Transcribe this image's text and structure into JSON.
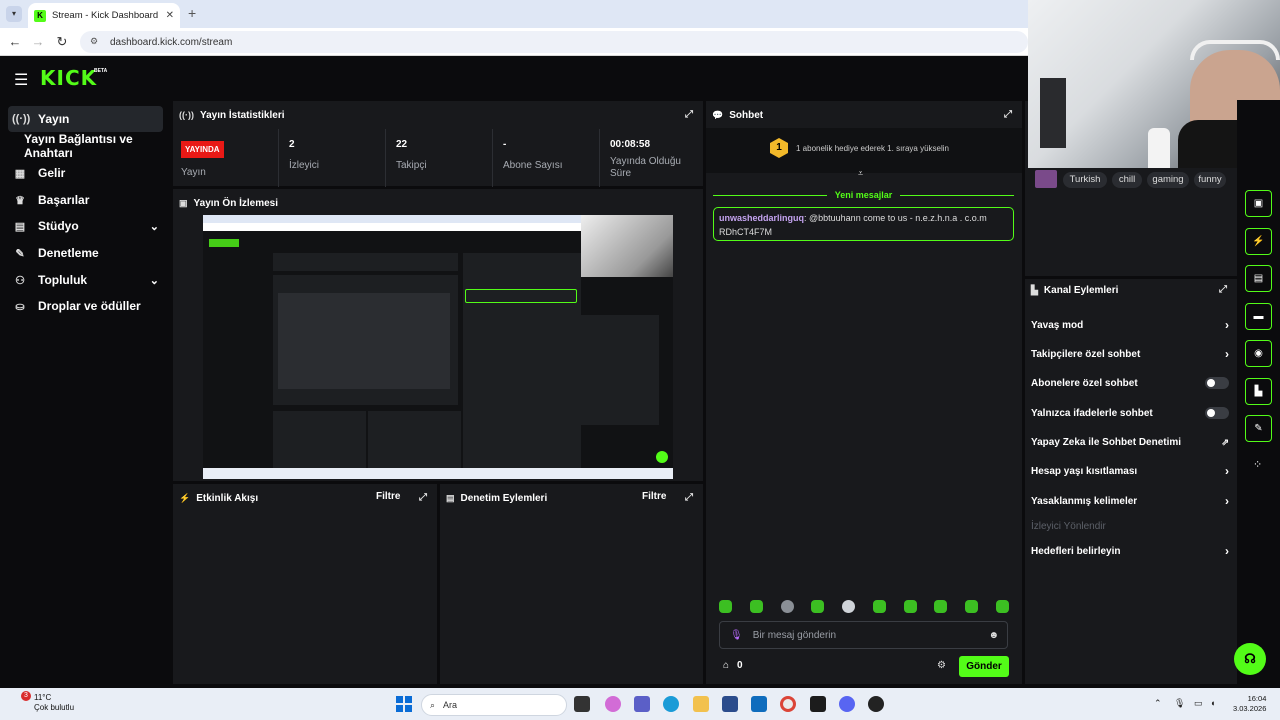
{
  "browser": {
    "tab_title": "Stream - Kick Dashboard",
    "tab_close": "✕",
    "new_tab": "+",
    "url": "dashboard.kick.com/stream"
  },
  "kick": {
    "logo": "KICK",
    "beta": "BETA"
  },
  "sidebar": {
    "items": [
      {
        "label": "Yayın",
        "icon": "broadcast-icon"
      },
      {
        "label": "Yayın Bağlantısı ve Anahtarı",
        "icon": ""
      },
      {
        "label": "Gelir",
        "icon": "revenue-icon"
      },
      {
        "label": "Başarılar",
        "icon": "trophy-icon"
      },
      {
        "label": "Stüdyo",
        "icon": "studio-icon"
      },
      {
        "label": "Denetleme",
        "icon": "wrench-icon"
      },
      {
        "label": "Topluluk",
        "icon": "community-icon"
      },
      {
        "label": "Droplar ve ödüller",
        "icon": "drops-icon"
      }
    ]
  },
  "stats": {
    "title": "Yayın İstatistikleri",
    "live_badge": "YAYINDA",
    "items": [
      {
        "value": "",
        "label": "Yayın"
      },
      {
        "value": "2",
        "label": "İzleyici"
      },
      {
        "value": "22",
        "label": "Takipçi"
      },
      {
        "value": "-",
        "label": "Abone Sayısı"
      },
      {
        "value": "00:08:58",
        "label": "Yayında Olduğu Süre"
      }
    ]
  },
  "preview": {
    "title": "Yayın Ön İzlemesi"
  },
  "activity": {
    "title": "Etkinlik Akışı",
    "filter": "Filtre"
  },
  "moderation": {
    "title": "Denetim Eylemleri",
    "filter": "Filtre"
  },
  "chat": {
    "title": "Sohbet",
    "gift_rank": "1",
    "gift_text": "1 abonelik hediye ederek 1. sıraya yükselin",
    "new_messages": "Yeni mesajlar",
    "messages": [
      {
        "user": "unwasheddarlinguq",
        "text": ": @bbtuuhann come to us - n.e.z.h.n.a . c.o.m RDhCT4F7M"
      }
    ],
    "input_placeholder": "Bir mesaj gönderin",
    "points": "0",
    "send": "Gönder"
  },
  "tags": [
    "Turkish",
    "chill",
    "gaming",
    "funny"
  ],
  "channel_actions": {
    "title": "Kanal Eylemleri",
    "items": [
      {
        "label": "Yavaş mod",
        "control": "chevron"
      },
      {
        "label": "Takipçilere özel sohbet",
        "control": "chevron"
      },
      {
        "label": "Abonelere özel sohbet",
        "control": "toggle"
      },
      {
        "label": "Yalnızca ifadelerle sohbet",
        "control": "toggle"
      },
      {
        "label": "Yapay Zeka ile Sohbet Denetimi",
        "control": "external"
      },
      {
        "label": "Hesap yaşı kısıtlaması",
        "control": "chevron"
      },
      {
        "label": "Yasaklanmış kelimeler",
        "control": "chevron"
      },
      {
        "label": "İzleyici Yönlendir",
        "control": "disabled"
      },
      {
        "label": "Hedefleri belirleyin",
        "control": "chevron"
      }
    ]
  },
  "taskbar": {
    "temperature": "11°C",
    "weather": "Çok bulutlu",
    "weather_badge": "3",
    "search_placeholder": "Ara",
    "time": "16:04",
    "date": "3.03.2026"
  },
  "colors": {
    "accent": "#53fc18",
    "live": "#e91916",
    "panel": "#18191c",
    "bg": "#0b0b0d"
  }
}
